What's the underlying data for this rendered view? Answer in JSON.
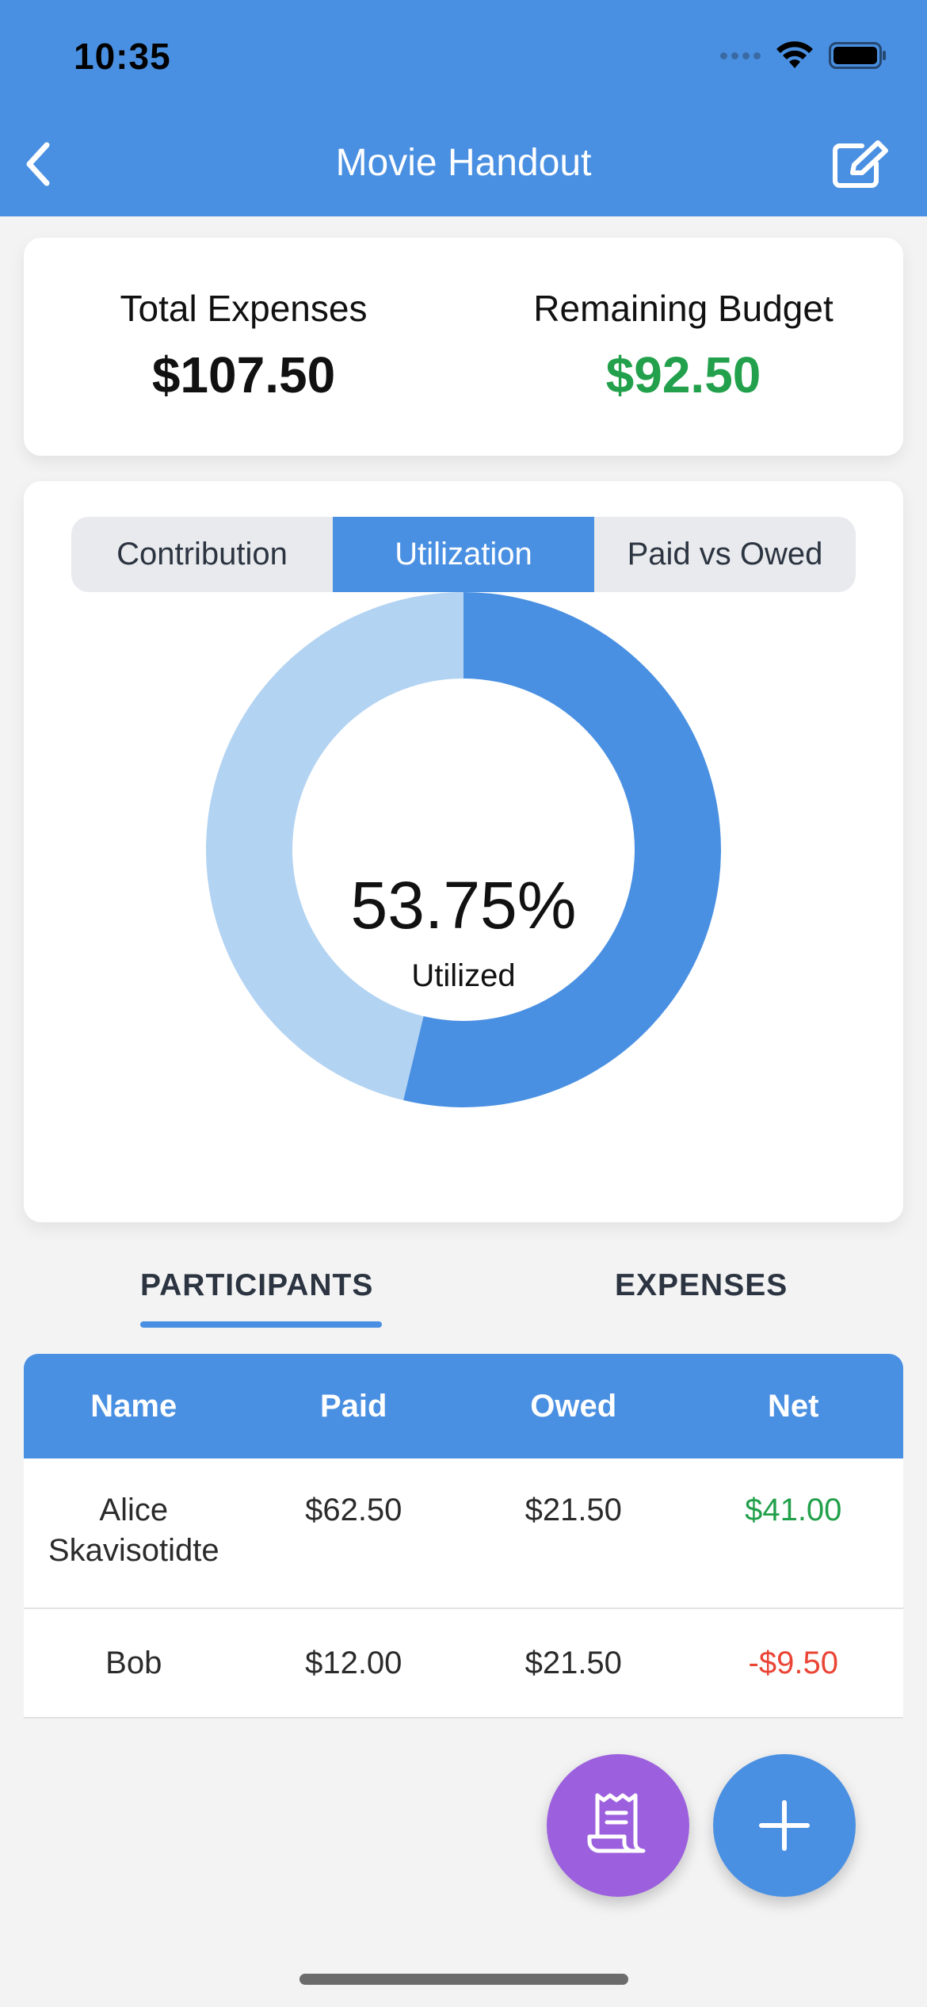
{
  "status_bar": {
    "time": "10:35"
  },
  "header": {
    "title": "Movie Handout",
    "back_icon": "chevron-left-icon",
    "edit_icon": "edit-icon"
  },
  "summary": {
    "total_expenses_label": "Total Expenses",
    "total_expenses_value": "$107.50",
    "remaining_budget_label": "Remaining Budget",
    "remaining_budget_value": "$92.50"
  },
  "chart_tabs": [
    "Contribution",
    "Utilization",
    "Paid vs Owed"
  ],
  "chart_tabs_selected": "Utilization",
  "chart_data": {
    "type": "pie",
    "values": [
      53.75,
      46.25
    ],
    "center_value": "53.75%",
    "center_label": "Utilized",
    "colors": [
      "#4a90e2",
      "#b3d3f2"
    ]
  },
  "section_tabs": {
    "participants": "PARTICIPANTS",
    "expenses": "EXPENSES",
    "selected": "PARTICIPANTS"
  },
  "table": {
    "headers": [
      "Name",
      "Paid",
      "Owed",
      "Net"
    ],
    "rows": [
      {
        "name": "Alice Skavisotidte",
        "paid": "$62.50",
        "owed": "$21.50",
        "net": "$41.00"
      },
      {
        "name": "Bob",
        "paid": "$12.00",
        "owed": "$21.50",
        "net": "-$9.50"
      }
    ]
  },
  "fabs": {
    "receipt_icon": "receipt-icon",
    "add_icon": "plus-icon"
  },
  "colors": {
    "accent": "#4a90e2",
    "positive": "#22a04b",
    "negative": "#ea4435",
    "fab_secondary": "#9c60de"
  }
}
